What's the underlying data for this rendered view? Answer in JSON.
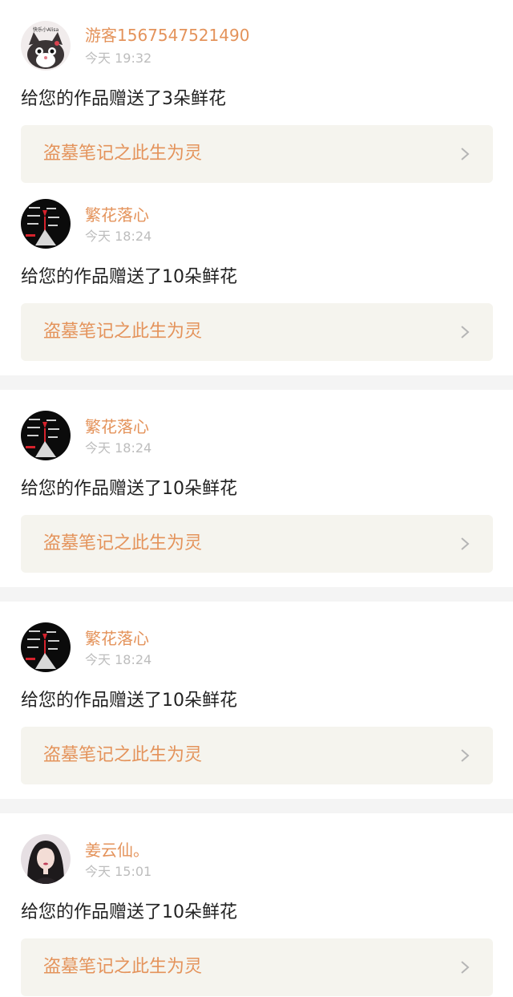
{
  "notifications": [
    {
      "username": "游客1567547521490",
      "time": "今天 19:32",
      "message": "给您的作品赠送了3朵鲜花",
      "work_title": "盗墓笔记之此生为灵",
      "avatar_icon": "cat-avatar-icon",
      "avatar_text": "快乐小Alisa"
    },
    {
      "username": "繁花落心",
      "time": "今天 18:24",
      "message": "给您的作品赠送了10朵鲜花",
      "work_title": "盗墓笔记之此生为灵",
      "avatar_icon": "dark-text-avatar-icon"
    },
    {
      "username": "繁花落心",
      "time": "今天 18:24",
      "message": "给您的作品赠送了10朵鲜花",
      "work_title": "盗墓笔记之此生为灵",
      "avatar_icon": "dark-text-avatar-icon"
    },
    {
      "username": "繁花落心",
      "time": "今天 18:24",
      "message": "给您的作品赠送了10朵鲜花",
      "work_title": "盗墓笔记之此生为灵",
      "avatar_icon": "dark-text-avatar-icon"
    },
    {
      "username": "姜云仙。",
      "time": "今天 15:01",
      "message": "给您的作品赠送了10朵鲜花",
      "work_title": "盗墓笔记之此生为灵",
      "avatar_icon": "girl-portrait-avatar-icon"
    }
  ],
  "colors": {
    "accent": "#e4935b",
    "time": "#bdbdbd",
    "text": "#222222",
    "link_bg": "#f5f4ee",
    "divider": "#f4f4f4"
  }
}
